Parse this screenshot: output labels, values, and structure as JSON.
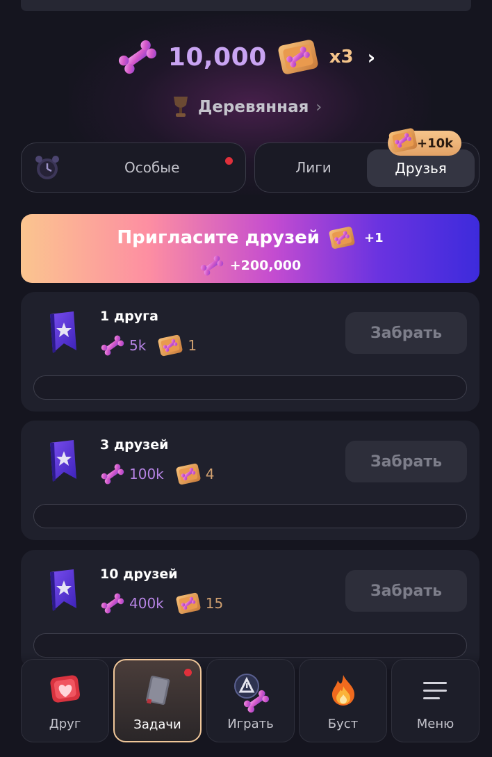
{
  "header": {
    "balance": "10,000",
    "multiplier": "x3"
  },
  "league": {
    "name": "Деревянная"
  },
  "tabs": {
    "special": "Особые",
    "leagues": "Лиги",
    "friends": "Друзья",
    "friends_bonus": "+10k"
  },
  "invite": {
    "title": "Пригласите друзей",
    "chest_bonus": "+1",
    "bone_bonus": "+200,000"
  },
  "tasks": [
    {
      "title": "1 друга",
      "bones": "5k",
      "chests": "1",
      "button": "Забрать",
      "progress": 0
    },
    {
      "title": "3 друзей",
      "bones": "100k",
      "chests": "4",
      "button": "Забрать",
      "progress": 0
    },
    {
      "title": "10 друзей",
      "bones": "400k",
      "chests": "15",
      "button": "Забрать",
      "progress": 0
    }
  ],
  "nav": [
    {
      "label": "Друг",
      "icon": "heart-shield-icon"
    },
    {
      "label": "Задачи",
      "icon": "book-icon"
    },
    {
      "label": "Играть",
      "icon": "play-bone-icon"
    },
    {
      "label": "Буст",
      "icon": "fire-icon"
    },
    {
      "label": "Меню",
      "icon": "menu-icon"
    }
  ],
  "colors": {
    "background": "#15151f",
    "card": "#1f202c",
    "balance": "#c9a4f2",
    "accent_gold": "#f5c48a",
    "notification": "#e0303b"
  }
}
